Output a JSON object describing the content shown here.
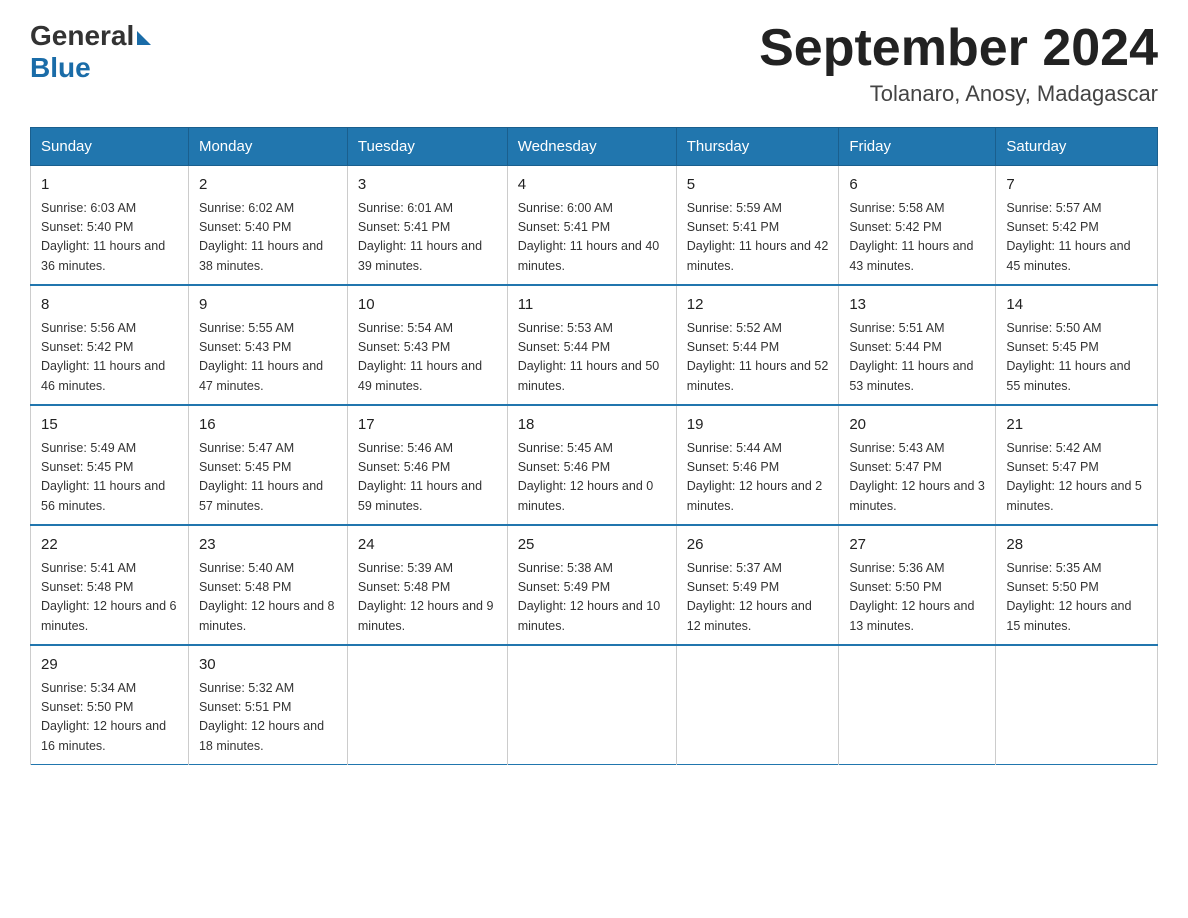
{
  "logo": {
    "general": "General",
    "blue": "Blue"
  },
  "title": "September 2024",
  "subtitle": "Tolanaro, Anosy, Madagascar",
  "days_of_week": [
    "Sunday",
    "Monday",
    "Tuesday",
    "Wednesday",
    "Thursday",
    "Friday",
    "Saturday"
  ],
  "weeks": [
    [
      {
        "num": "1",
        "sunrise": "6:03 AM",
        "sunset": "5:40 PM",
        "daylight": "11 hours and 36 minutes."
      },
      {
        "num": "2",
        "sunrise": "6:02 AM",
        "sunset": "5:40 PM",
        "daylight": "11 hours and 38 minutes."
      },
      {
        "num": "3",
        "sunrise": "6:01 AM",
        "sunset": "5:41 PM",
        "daylight": "11 hours and 39 minutes."
      },
      {
        "num": "4",
        "sunrise": "6:00 AM",
        "sunset": "5:41 PM",
        "daylight": "11 hours and 40 minutes."
      },
      {
        "num": "5",
        "sunrise": "5:59 AM",
        "sunset": "5:41 PM",
        "daylight": "11 hours and 42 minutes."
      },
      {
        "num": "6",
        "sunrise": "5:58 AM",
        "sunset": "5:42 PM",
        "daylight": "11 hours and 43 minutes."
      },
      {
        "num": "7",
        "sunrise": "5:57 AM",
        "sunset": "5:42 PM",
        "daylight": "11 hours and 45 minutes."
      }
    ],
    [
      {
        "num": "8",
        "sunrise": "5:56 AM",
        "sunset": "5:42 PM",
        "daylight": "11 hours and 46 minutes."
      },
      {
        "num": "9",
        "sunrise": "5:55 AM",
        "sunset": "5:43 PM",
        "daylight": "11 hours and 47 minutes."
      },
      {
        "num": "10",
        "sunrise": "5:54 AM",
        "sunset": "5:43 PM",
        "daylight": "11 hours and 49 minutes."
      },
      {
        "num": "11",
        "sunrise": "5:53 AM",
        "sunset": "5:44 PM",
        "daylight": "11 hours and 50 minutes."
      },
      {
        "num": "12",
        "sunrise": "5:52 AM",
        "sunset": "5:44 PM",
        "daylight": "11 hours and 52 minutes."
      },
      {
        "num": "13",
        "sunrise": "5:51 AM",
        "sunset": "5:44 PM",
        "daylight": "11 hours and 53 minutes."
      },
      {
        "num": "14",
        "sunrise": "5:50 AM",
        "sunset": "5:45 PM",
        "daylight": "11 hours and 55 minutes."
      }
    ],
    [
      {
        "num": "15",
        "sunrise": "5:49 AM",
        "sunset": "5:45 PM",
        "daylight": "11 hours and 56 minutes."
      },
      {
        "num": "16",
        "sunrise": "5:47 AM",
        "sunset": "5:45 PM",
        "daylight": "11 hours and 57 minutes."
      },
      {
        "num": "17",
        "sunrise": "5:46 AM",
        "sunset": "5:46 PM",
        "daylight": "11 hours and 59 minutes."
      },
      {
        "num": "18",
        "sunrise": "5:45 AM",
        "sunset": "5:46 PM",
        "daylight": "12 hours and 0 minutes."
      },
      {
        "num": "19",
        "sunrise": "5:44 AM",
        "sunset": "5:46 PM",
        "daylight": "12 hours and 2 minutes."
      },
      {
        "num": "20",
        "sunrise": "5:43 AM",
        "sunset": "5:47 PM",
        "daylight": "12 hours and 3 minutes."
      },
      {
        "num": "21",
        "sunrise": "5:42 AM",
        "sunset": "5:47 PM",
        "daylight": "12 hours and 5 minutes."
      }
    ],
    [
      {
        "num": "22",
        "sunrise": "5:41 AM",
        "sunset": "5:48 PM",
        "daylight": "12 hours and 6 minutes."
      },
      {
        "num": "23",
        "sunrise": "5:40 AM",
        "sunset": "5:48 PM",
        "daylight": "12 hours and 8 minutes."
      },
      {
        "num": "24",
        "sunrise": "5:39 AM",
        "sunset": "5:48 PM",
        "daylight": "12 hours and 9 minutes."
      },
      {
        "num": "25",
        "sunrise": "5:38 AM",
        "sunset": "5:49 PM",
        "daylight": "12 hours and 10 minutes."
      },
      {
        "num": "26",
        "sunrise": "5:37 AM",
        "sunset": "5:49 PM",
        "daylight": "12 hours and 12 minutes."
      },
      {
        "num": "27",
        "sunrise": "5:36 AM",
        "sunset": "5:50 PM",
        "daylight": "12 hours and 13 minutes."
      },
      {
        "num": "28",
        "sunrise": "5:35 AM",
        "sunset": "5:50 PM",
        "daylight": "12 hours and 15 minutes."
      }
    ],
    [
      {
        "num": "29",
        "sunrise": "5:34 AM",
        "sunset": "5:50 PM",
        "daylight": "12 hours and 16 minutes."
      },
      {
        "num": "30",
        "sunrise": "5:32 AM",
        "sunset": "5:51 PM",
        "daylight": "12 hours and 18 minutes."
      },
      null,
      null,
      null,
      null,
      null
    ]
  ]
}
